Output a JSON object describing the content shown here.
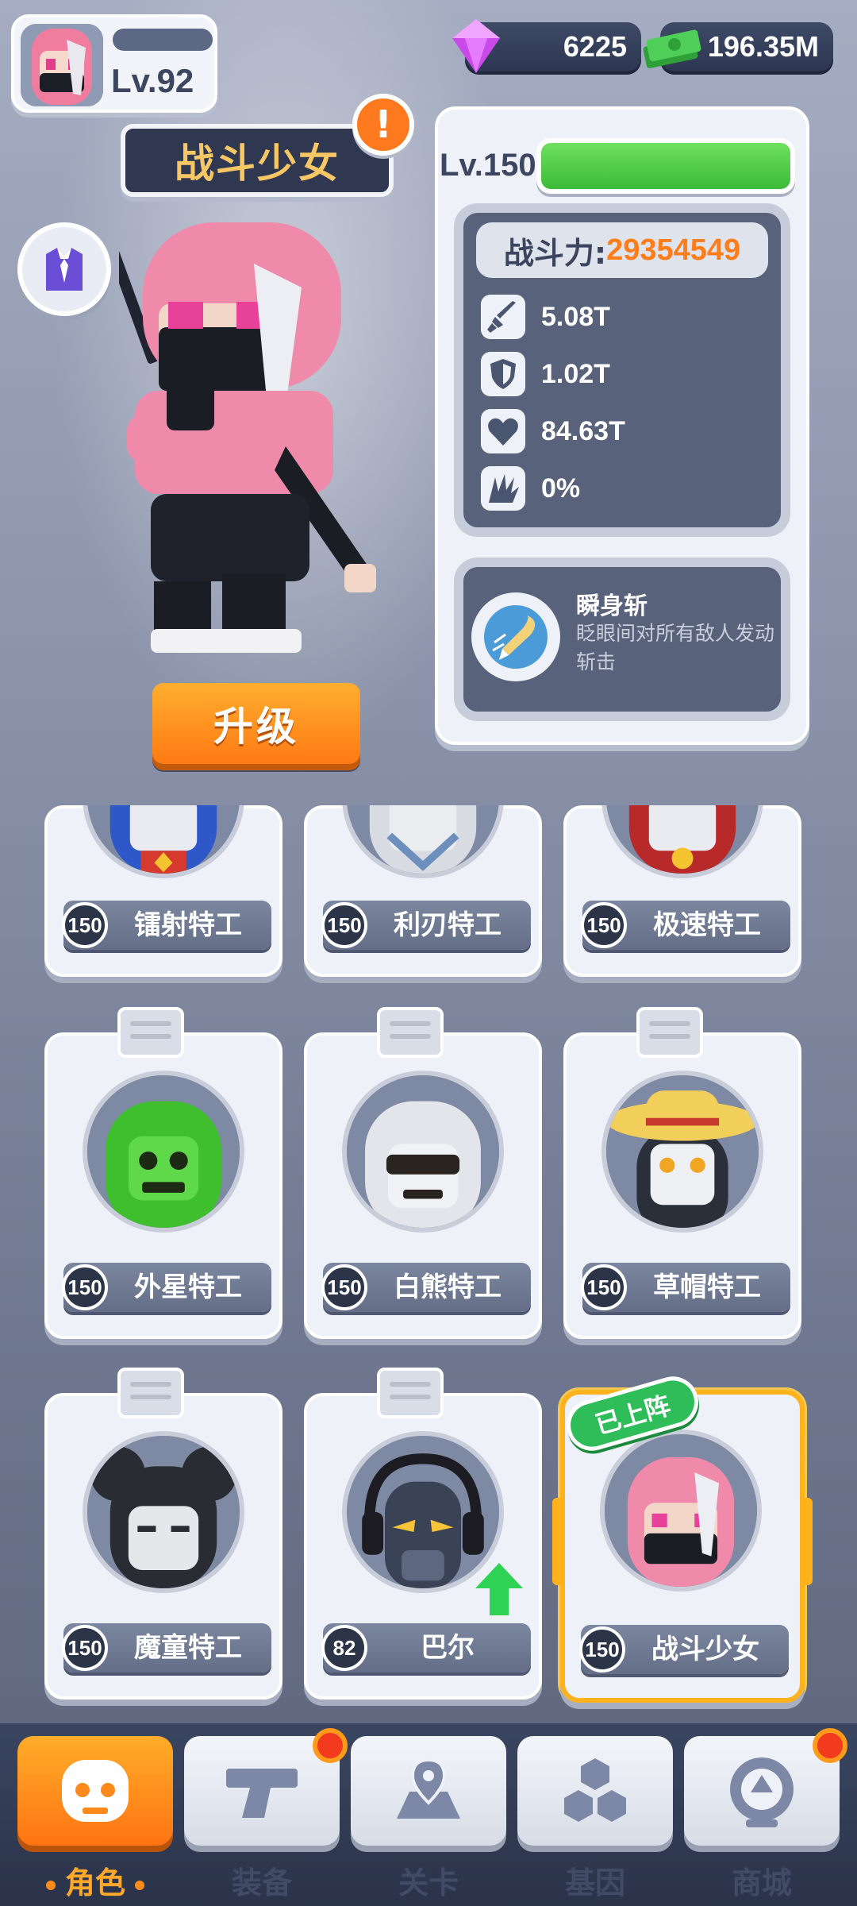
{
  "player": {
    "level": "Lv.92"
  },
  "currency": {
    "gems": "6225",
    "cash": "196.35M"
  },
  "hero": {
    "name": "战斗少女",
    "alert": "!",
    "level": "Lv.150",
    "exp_fraction": 1.0,
    "upgrade_label": "升级",
    "power_label": "战斗力:",
    "power_value": "29354549",
    "stats": [
      {
        "icon": "attack-sword-icon",
        "value": "5.08T"
      },
      {
        "icon": "defense-shield-icon",
        "value": "1.02T"
      },
      {
        "icon": "health-heart-icon",
        "value": "84.63T"
      },
      {
        "icon": "crit-claw-icon",
        "value": "0%"
      }
    ],
    "skill": {
      "icon": "dash-slash-icon",
      "name": "瞬身斩",
      "desc": "眨眼间对所有敌人发动斩击"
    }
  },
  "roster": [
    {
      "level": "150",
      "name": "镭射特工"
    },
    {
      "level": "150",
      "name": "利刃特工"
    },
    {
      "level": "150",
      "name": "极速特工"
    },
    {
      "level": "150",
      "name": "外星特工"
    },
    {
      "level": "150",
      "name": "白熊特工"
    },
    {
      "level": "150",
      "name": "草帽特工"
    },
    {
      "level": "150",
      "name": "魔童特工"
    },
    {
      "level": "82",
      "name": "巴尔"
    },
    {
      "level": "150",
      "name": "战斗少女",
      "tag": "已上阵"
    }
  ],
  "nav": [
    {
      "label": "角色",
      "icon": "skull-character-icon",
      "active": true
    },
    {
      "label": "装备",
      "icon": "gun-equipment-icon",
      "badge": true
    },
    {
      "label": "关卡",
      "icon": "map-pin-icon"
    },
    {
      "label": "基因",
      "icon": "hexagon-gene-icon"
    },
    {
      "label": "商城",
      "icon": "shop-badge-icon",
      "badge": true
    }
  ],
  "colors": {
    "accent_orange": "#ff7a14",
    "power_orange": "#ff7d1a",
    "exp_green": "#3bbb38",
    "deployed_green": "#2ebd58",
    "panel_dark": "#59627b"
  }
}
